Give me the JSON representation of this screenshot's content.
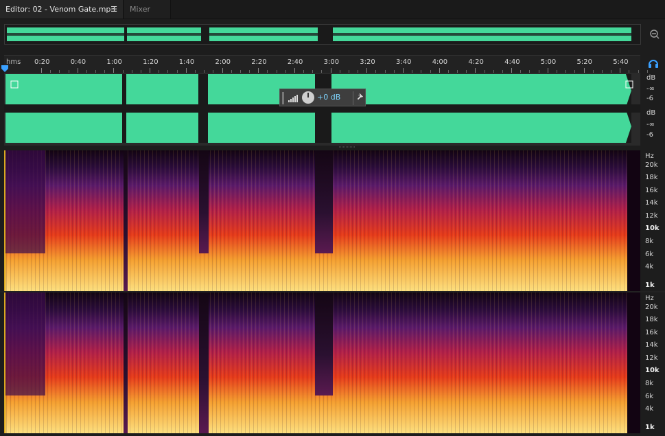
{
  "tabs": {
    "editor_label": "Editor: 02 - Venom Gate.mp3",
    "editor_menu": "☰",
    "mixer_label": "Mixer"
  },
  "ruler": {
    "unit_label": "hms",
    "ticks": [
      "0:20",
      "0:40",
      "1:00",
      "1:20",
      "1:40",
      "2:00",
      "2:20",
      "2:40",
      "3:00",
      "3:20",
      "3:40",
      "4:00",
      "4:20",
      "4:40",
      "5:00",
      "5:20",
      "5:40"
    ]
  },
  "db_scale": {
    "top": {
      "unit": "dB",
      "inf": "-∞",
      "minus6": "-6"
    },
    "bottom": {
      "unit": "dB",
      "inf": "-∞",
      "minus6": "-6"
    }
  },
  "hud": {
    "volume_value": "+0 dB"
  },
  "hz_scale": {
    "unit": "Hz",
    "labels": [
      "20k",
      "18k",
      "16k",
      "14k",
      "12k",
      "10k",
      "8k",
      "6k",
      "4k",
      "1k"
    ]
  },
  "colors": {
    "waveform": "#44d89a",
    "waveform_dark": "#35b07e",
    "accent_blue": "#3aa0ff",
    "background": "#1d1d1d"
  }
}
